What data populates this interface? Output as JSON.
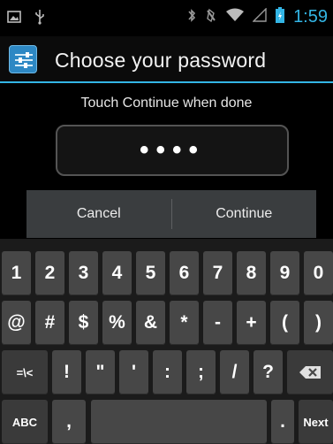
{
  "status_bar": {
    "time": "1:59",
    "icons_left": [
      "screenshot-icon",
      "usb-icon"
    ],
    "icons_right": [
      "bluetooth-icon",
      "vibrate-icon",
      "wifi-icon",
      "signal-icon",
      "battery-icon"
    ]
  },
  "title_bar": {
    "title": "Choose your password"
  },
  "content": {
    "hint": "Touch Continue when done",
    "password_value": "••••"
  },
  "buttons": {
    "cancel": "Cancel",
    "continue": "Continue"
  },
  "keyboard": {
    "row1": [
      "1",
      "2",
      "3",
      "4",
      "5",
      "6",
      "7",
      "8",
      "9",
      "0"
    ],
    "row2": [
      "@",
      "#",
      "$",
      "%",
      "&",
      "*",
      "-",
      "+",
      "(",
      ")"
    ],
    "row3": [
      "=\\<",
      "!",
      "\"",
      "'",
      ":",
      ";",
      "/",
      "?"
    ],
    "row4_left": "ABC",
    "row4_comma": ",",
    "row4_period": ".",
    "row4_next": "Next"
  },
  "colors": {
    "accent": "#33b5e5",
    "key": "#474747",
    "background": "#000000"
  }
}
